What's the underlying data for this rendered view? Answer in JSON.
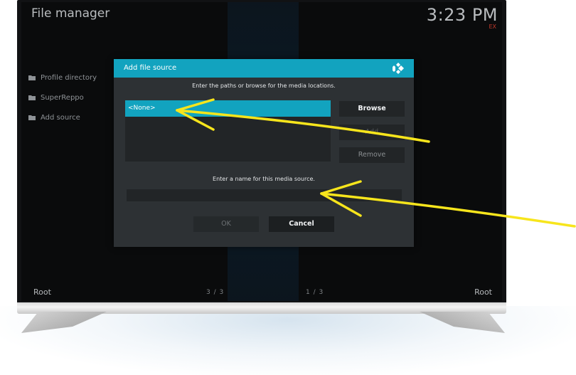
{
  "header": {
    "title": "File manager",
    "clock": "3:23 PM",
    "clock_badge": "EX"
  },
  "sidebar": {
    "items": [
      {
        "label": "Profile directory",
        "icon": "folder-icon"
      },
      {
        "label": "SuperReppo",
        "icon": "folder-icon"
      },
      {
        "label": "Add source",
        "icon": "folder-icon"
      }
    ]
  },
  "footer": {
    "left_label": "Root",
    "right_label": "Root",
    "left_page": "3 / 3",
    "right_page": "1 / 3"
  },
  "dialog": {
    "title": "Add file source",
    "icon": "kodi-logo-icon",
    "paths_instruction": "Enter the paths or browse for the media locations.",
    "paths": [
      "<None>"
    ],
    "browse_label": "Browse",
    "add_label": "Add",
    "remove_label": "Remove",
    "name_instruction": "Enter a name for this media source.",
    "name_value": "",
    "ok_label": "OK",
    "cancel_label": "Cancel"
  },
  "colors": {
    "accent": "#12a3bf",
    "annotation": "#f7e51c",
    "dialog_bg": "#2d3134",
    "screen_bg": "#0a0b0c"
  }
}
